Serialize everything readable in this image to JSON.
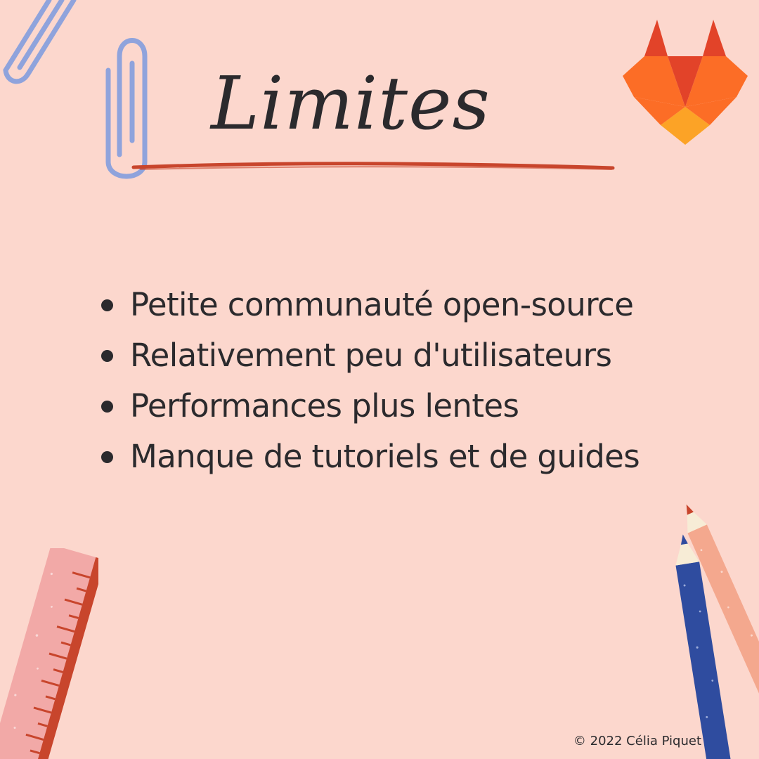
{
  "title": "Limites",
  "items": [
    "Petite communauté open-source",
    "Relativement peu d'utilisateurs",
    "Performances plus lentes",
    "Manque de tutoriels et de guides"
  ],
  "footer": {
    "copyright": "© 2022 Célia Piquet"
  },
  "colors": {
    "background": "#fcd7cd",
    "text": "#2b2a2d",
    "underline": "#c8452c",
    "paperclip": "#8fa3dc",
    "logo_dark": "#e24329",
    "logo_mid": "#fc6d26",
    "logo_light": "#fca326"
  },
  "decorations": {
    "logo_icon": "gitlab-fox-icon",
    "clip_icon": "paperclip-icon",
    "ruler_icon": "ruler-icon",
    "pencil_icon": "pencil-icon"
  }
}
